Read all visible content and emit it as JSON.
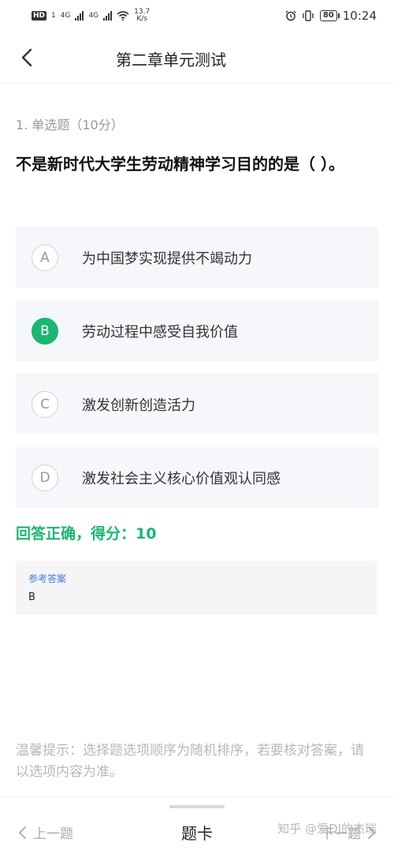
{
  "status_bar": {
    "hd_badge": "HD",
    "sim": "1",
    "net1": "4G",
    "net2": "4G",
    "speed_value": "13.7",
    "speed_unit": "K/s",
    "battery": "80",
    "time": "10:24"
  },
  "header": {
    "title": "第二章单元测试"
  },
  "question": {
    "meta": "1. 单选题（10分）",
    "text": "不是新时代大学生劳动精神学习目的的是（ ）。",
    "options": [
      {
        "letter": "A",
        "text": "为中国梦实现提供不竭动力",
        "selected": false
      },
      {
        "letter": "B",
        "text": "劳动过程中感受自我价值",
        "selected": true
      },
      {
        "letter": "C",
        "text": "激发创新创造活力",
        "selected": false
      },
      {
        "letter": "D",
        "text": "激发社会主义核心价值观认同感",
        "selected": false
      }
    ]
  },
  "result": {
    "text": "回答正确，得分：10"
  },
  "reference": {
    "label": "参考答案",
    "value": "B"
  },
  "tip": "温馨提示：选择题选项顺序为随机排序，若要核对答案，请以选项内容为准。",
  "footer": {
    "prev_label": "上一题",
    "card_label": "题卡",
    "next_label": "下一题",
    "watermark": "知乎 @爱DJ的杰瑞"
  },
  "colors": {
    "accent_green": "#1bb673",
    "reference_blue": "#3a7de0",
    "option_bg": "#f5f7fa"
  },
  "icons": [
    "back-chevron-icon",
    "prev-chevron-icon",
    "next-chevron-icon",
    "wifi-icon",
    "alarm-icon",
    "vibrate-icon",
    "signal-icon",
    "battery-icon"
  ]
}
